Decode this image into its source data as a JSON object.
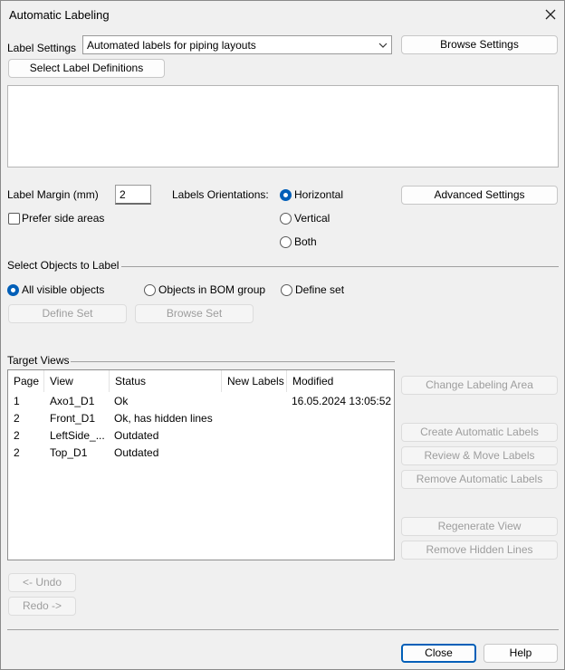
{
  "window": {
    "title": "Automatic Labeling"
  },
  "icons": {
    "close": "close-icon",
    "dropdown": "chevron-down-icon"
  },
  "label_settings": {
    "label": "Label Settings",
    "selected": "Automated labels for piping layouts",
    "browse_button": "Browse Settings",
    "select_definitions_button": "Select Label Definitions",
    "definitions_text": ""
  },
  "margin": {
    "label": "Label Margin (mm)",
    "value": "2"
  },
  "prefer_side_areas": {
    "label": "Prefer side areas",
    "checked": false
  },
  "orientation": {
    "label": "Labels Orientations:",
    "options": [
      "Horizontal",
      "Vertical",
      "Both"
    ],
    "selected": "Horizontal"
  },
  "advanced_settings_button": "Advanced Settings",
  "select_objects": {
    "title": "Select Objects to Label",
    "options": [
      "All visible objects",
      "Objects in BOM group",
      "Define set"
    ],
    "selected": "All visible objects",
    "define_set_button": "Define Set",
    "browse_set_button": "Browse Set"
  },
  "target_views": {
    "title": "Target Views",
    "columns": [
      "Page",
      "View",
      "Status",
      "New Labels",
      "Modified"
    ],
    "rows": [
      {
        "page": "1",
        "view": "Axo1_D1",
        "status": "Ok",
        "new_labels": "",
        "modified": "16.05.2024 13:05:52"
      },
      {
        "page": "2",
        "view": "Front_D1",
        "status": "Ok, has hidden lines",
        "new_labels": "",
        "modified": ""
      },
      {
        "page": "2",
        "view": "LeftSide_...",
        "status": "Outdated",
        "new_labels": "",
        "modified": ""
      },
      {
        "page": "2",
        "view": "Top_D1",
        "status": "Outdated",
        "new_labels": "",
        "modified": ""
      }
    ]
  },
  "side_buttons": {
    "change_area": "Change Labeling Area",
    "create": "Create Automatic Labels",
    "review": "Review & Move Labels",
    "remove": "Remove Automatic Labels",
    "regenerate": "Regenerate View",
    "remove_hidden": "Remove Hidden Lines"
  },
  "undo_button": "<- Undo",
  "redo_button": "Redo ->",
  "close_button": "Close",
  "help_button": "Help"
}
